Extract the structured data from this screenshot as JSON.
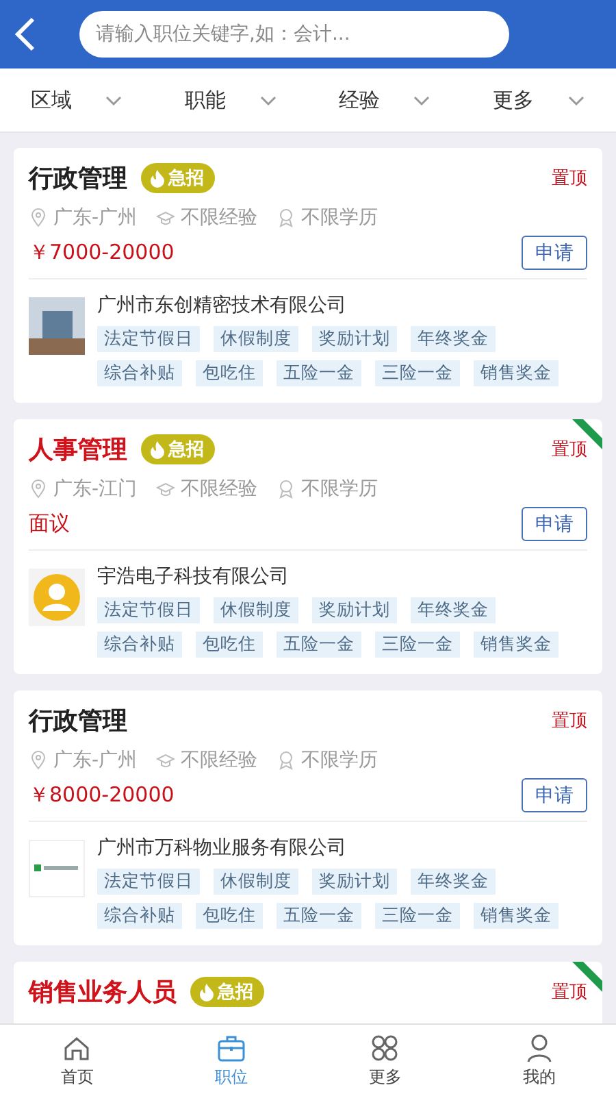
{
  "header": {
    "search": {
      "placeholder": "请输入职位关键字,如：会计..."
    }
  },
  "filters": [
    {
      "label": "区域"
    },
    {
      "label": "职能"
    },
    {
      "label": "经验"
    },
    {
      "label": "更多"
    }
  ],
  "jobs": [
    {
      "title": "行政管理",
      "highlight": false,
      "urgent_badge": "急招",
      "top_label": "置顶",
      "ribbon": false,
      "location": "广东-广州",
      "experience": "不限经验",
      "education": "不限学历",
      "salary": "￥7000-20000",
      "apply": "申请",
      "company": "广州市东创精密技术有限公司",
      "logo": {
        "kind": "photo"
      },
      "tags": [
        "法定节假日",
        "休假制度",
        "奖励计划",
        "年终奖金",
        "综合补贴",
        "包吃住",
        "五险一金",
        "三险一金",
        "销售奖金"
      ]
    },
    {
      "title": "人事管理",
      "highlight": true,
      "urgent_badge": "急招",
      "top_label": "置顶",
      "ribbon": true,
      "location": "广东-江门",
      "experience": "不限经验",
      "education": "不限学历",
      "salary": "面议",
      "apply": "申请",
      "company": "宇浩电子科技有限公司",
      "logo": {
        "kind": "avatar"
      },
      "tags": [
        "法定节假日",
        "休假制度",
        "奖励计划",
        "年终奖金",
        "综合补贴",
        "包吃住",
        "五险一金",
        "三险一金",
        "销售奖金"
      ]
    },
    {
      "title": "行政管理",
      "highlight": false,
      "top_label": "置顶",
      "ribbon": false,
      "location": "广东-广州",
      "experience": "不限经验",
      "education": "不限学历",
      "salary": "￥8000-20000",
      "apply": "申请",
      "company": "广州市万科物业服务有限公司",
      "logo": {
        "kind": "wordmark"
      },
      "tags": [
        "法定节假日",
        "休假制度",
        "奖励计划",
        "年终奖金",
        "综合补贴",
        "包吃住",
        "五险一金",
        "三险一金",
        "销售奖金"
      ]
    },
    {
      "title": "销售业务人员",
      "highlight": true,
      "urgent_badge": "急招",
      "top_label": "置顶",
      "ribbon": true
    }
  ],
  "tabbar": [
    {
      "label": "首页",
      "kind": "home",
      "selected": false
    },
    {
      "label": "职位",
      "kind": "briefcase",
      "selected": true
    },
    {
      "label": "更多",
      "kind": "grid",
      "selected": false
    },
    {
      "label": "我的",
      "kind": "person",
      "selected": false
    }
  ]
}
